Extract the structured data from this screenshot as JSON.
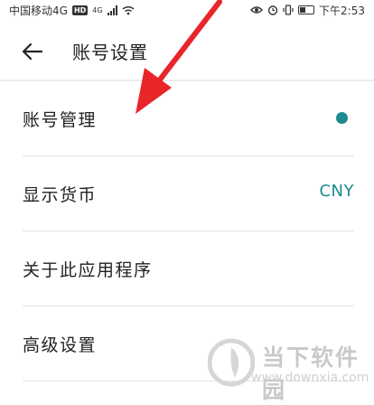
{
  "status_bar": {
    "carrier": "中国移动4G",
    "hd_badge": "HD",
    "network": "4G",
    "time": "下午2:53"
  },
  "header": {
    "title": "账号设置",
    "back_icon": "arrow-left-icon"
  },
  "settings": {
    "items": [
      {
        "label": "账号管理",
        "indicator": "dot",
        "indicator_color": "#1b8b8f"
      },
      {
        "label": "显示货币",
        "value": "CNY"
      },
      {
        "label": "关于此应用程序"
      },
      {
        "label": "高级设置"
      }
    ]
  },
  "watermark": {
    "name": "当下软件园",
    "url": "www.downxia.com"
  },
  "colors": {
    "accent": "#1b8b8f",
    "annotation_arrow": "#e8262a"
  }
}
